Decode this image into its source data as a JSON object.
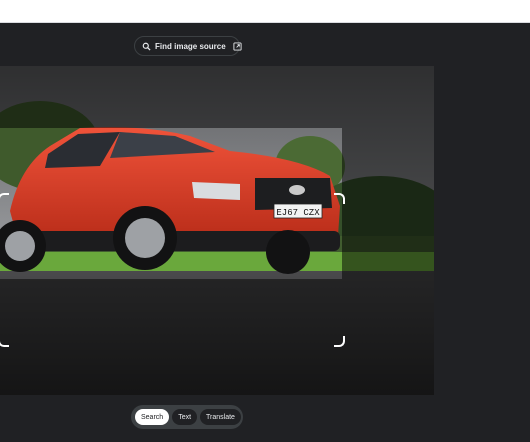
{
  "header": {
    "source_button_label": "Find image source"
  },
  "image": {
    "plate_text": "EJ67 CZX"
  },
  "modes": [
    {
      "label": "Search",
      "active": true
    },
    {
      "label": "Text",
      "active": false
    },
    {
      "label": "Translate",
      "active": false
    }
  ],
  "icons": {
    "source": "lens-search-icon",
    "open": "open-external-icon"
  }
}
